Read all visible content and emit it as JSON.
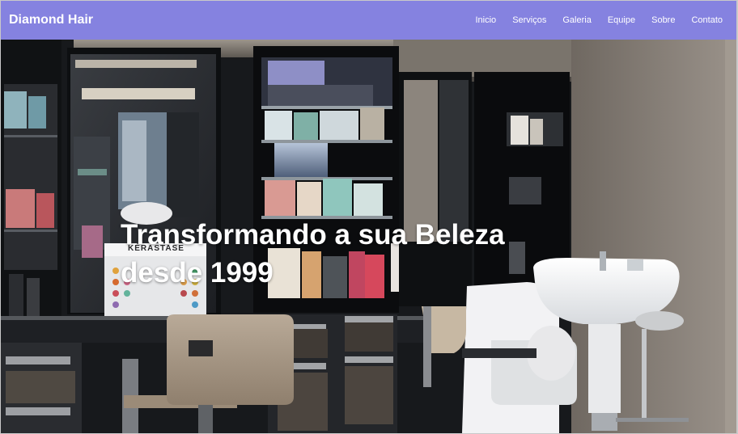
{
  "navbar": {
    "brand": "Diamond Hair",
    "links": [
      "Inicio",
      "Serviços",
      "Galeria",
      "Equipe",
      "Sobre",
      "Contato"
    ]
  },
  "hero": {
    "title_line1": "Transformando a sua Beleza",
    "title_line2": "desde 1999",
    "product_brand_sign": "KÉRASTASE"
  },
  "colors": {
    "navbar_bg": "#8582e0",
    "text": "#ffffff",
    "wall": "#8d857e",
    "cabinet": "#15171a"
  }
}
